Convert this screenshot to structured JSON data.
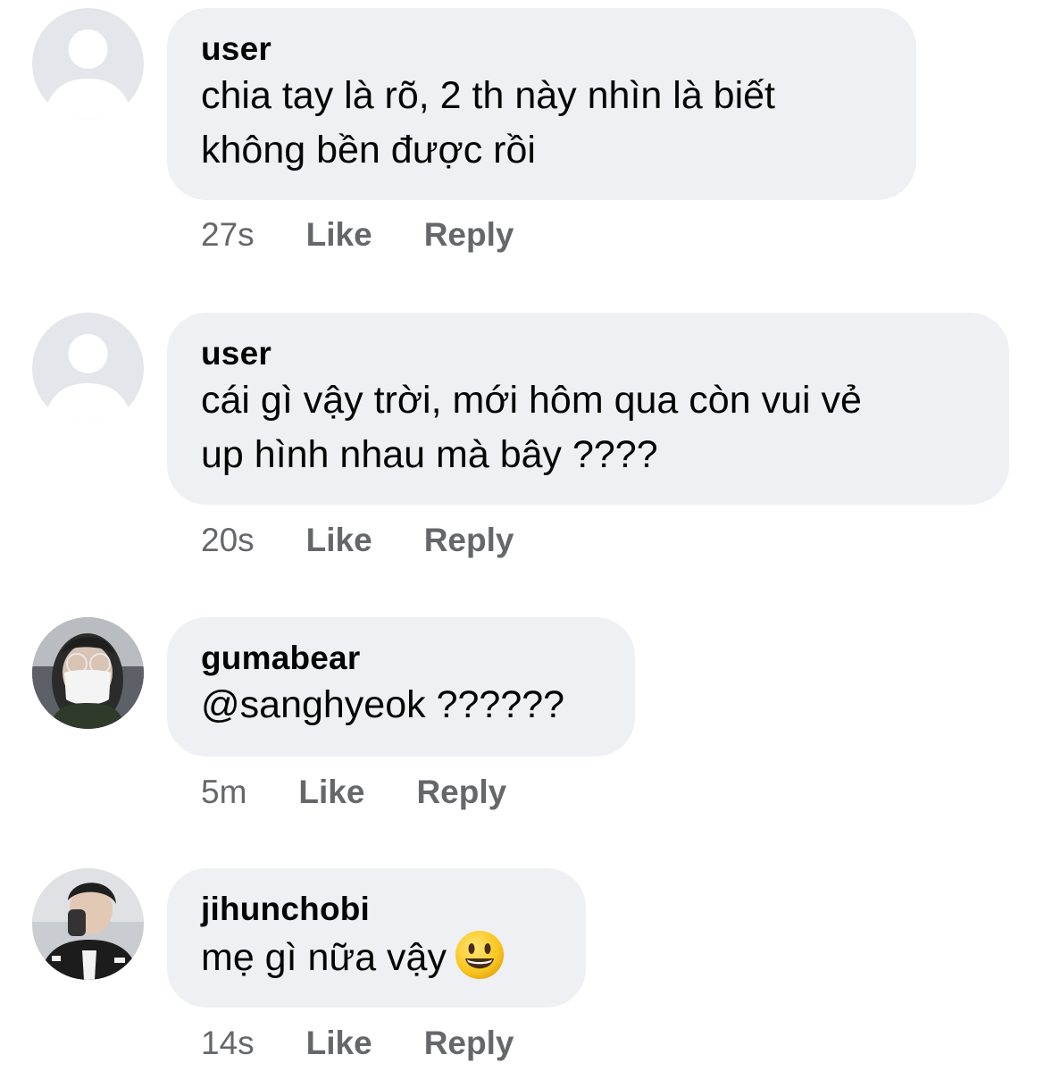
{
  "comments": [
    {
      "username": "user",
      "lines": [
        "chia tay là rõ, 2 th này nhìn là biết",
        "không bền được rồi"
      ],
      "time": "27s",
      "like_label": "Like",
      "reply_label": "Reply",
      "avatar": "default-avatar-icon"
    },
    {
      "username": "user",
      "lines": [
        "cái gì vậy trời, mới hôm qua còn vui vẻ",
        "up hình nhau mà bây ????"
      ],
      "time": "20s",
      "like_label": "Like",
      "reply_label": "Reply",
      "avatar": "default-avatar-icon"
    },
    {
      "username": "gumabear",
      "lines": [
        "@sanghyeok ??????"
      ],
      "time": "5m",
      "like_label": "Like",
      "reply_label": "Reply",
      "avatar": "profile-photo"
    },
    {
      "username": "jihunchobi",
      "lines": [
        "mẹ gì nữa vậy"
      ],
      "emoji": "grinning-face-emoji",
      "time": "14s",
      "like_label": "Like",
      "reply_label": "Reply",
      "avatar": "profile-photo"
    }
  ],
  "colors": {
    "bubble": "#eff0f3",
    "meta_text": "#65676b",
    "default_avatar_bg": "#e4e6eb",
    "default_avatar_fg": "#ffffff"
  }
}
